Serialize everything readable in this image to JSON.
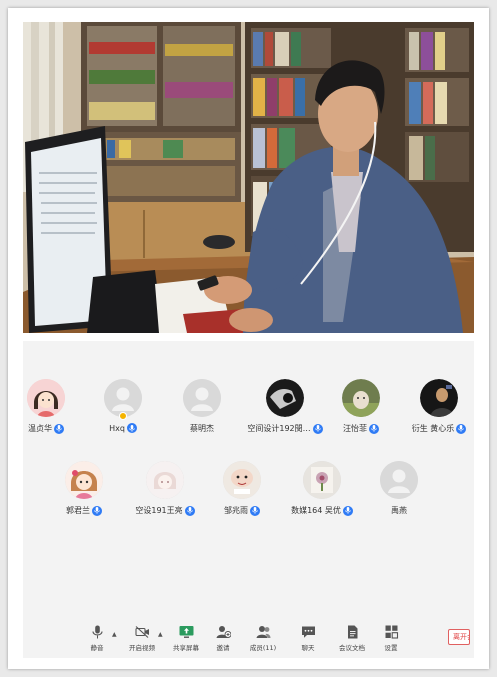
{
  "participants": [
    {
      "name": "温贞华",
      "avatar": "cartoon-girl-avatar",
      "mic": true
    },
    {
      "name": "Hxq",
      "avatar": "default-person-avatar",
      "mic": true,
      "host_badge": true
    },
    {
      "name": "蔡明杰",
      "avatar": "default-person-avatar",
      "mic": false
    },
    {
      "name": "空间设计192閔…",
      "avatar": "dark-photo-avatar",
      "mic": true
    },
    {
      "name": "汪怡菲",
      "avatar": "animal-photo-avatar",
      "mic": true
    },
    {
      "name": "衍生 黄心乐",
      "avatar": "dark-portrait-avatar",
      "mic": true
    },
    {
      "name": "郭君兰",
      "avatar": "cartoon-character-avatar",
      "mic": true
    },
    {
      "name": "空设191王亮",
      "avatar": "pale-illustration-avatar",
      "mic": true
    },
    {
      "name": "邹兆雨",
      "avatar": "meme-face-avatar",
      "mic": true
    },
    {
      "name": "数媒164 吴优",
      "avatar": "flower-photo-avatar",
      "mic": true
    },
    {
      "name": "禹燕",
      "avatar": "default-person-avatar",
      "mic": false
    }
  ],
  "toolbar": {
    "mute": "静音",
    "start_video": "开启视频",
    "share_screen": "共享屏幕",
    "invite": "邀请",
    "members": "成员(11)",
    "chat": "聊天",
    "meeting_docs": "会议文档",
    "settings": "设置",
    "leave": "离开会议"
  },
  "colors": {
    "mic_badge": "#2f7bf5",
    "leave_text": "#e04545",
    "panel_bg": "#f3f3f3"
  }
}
